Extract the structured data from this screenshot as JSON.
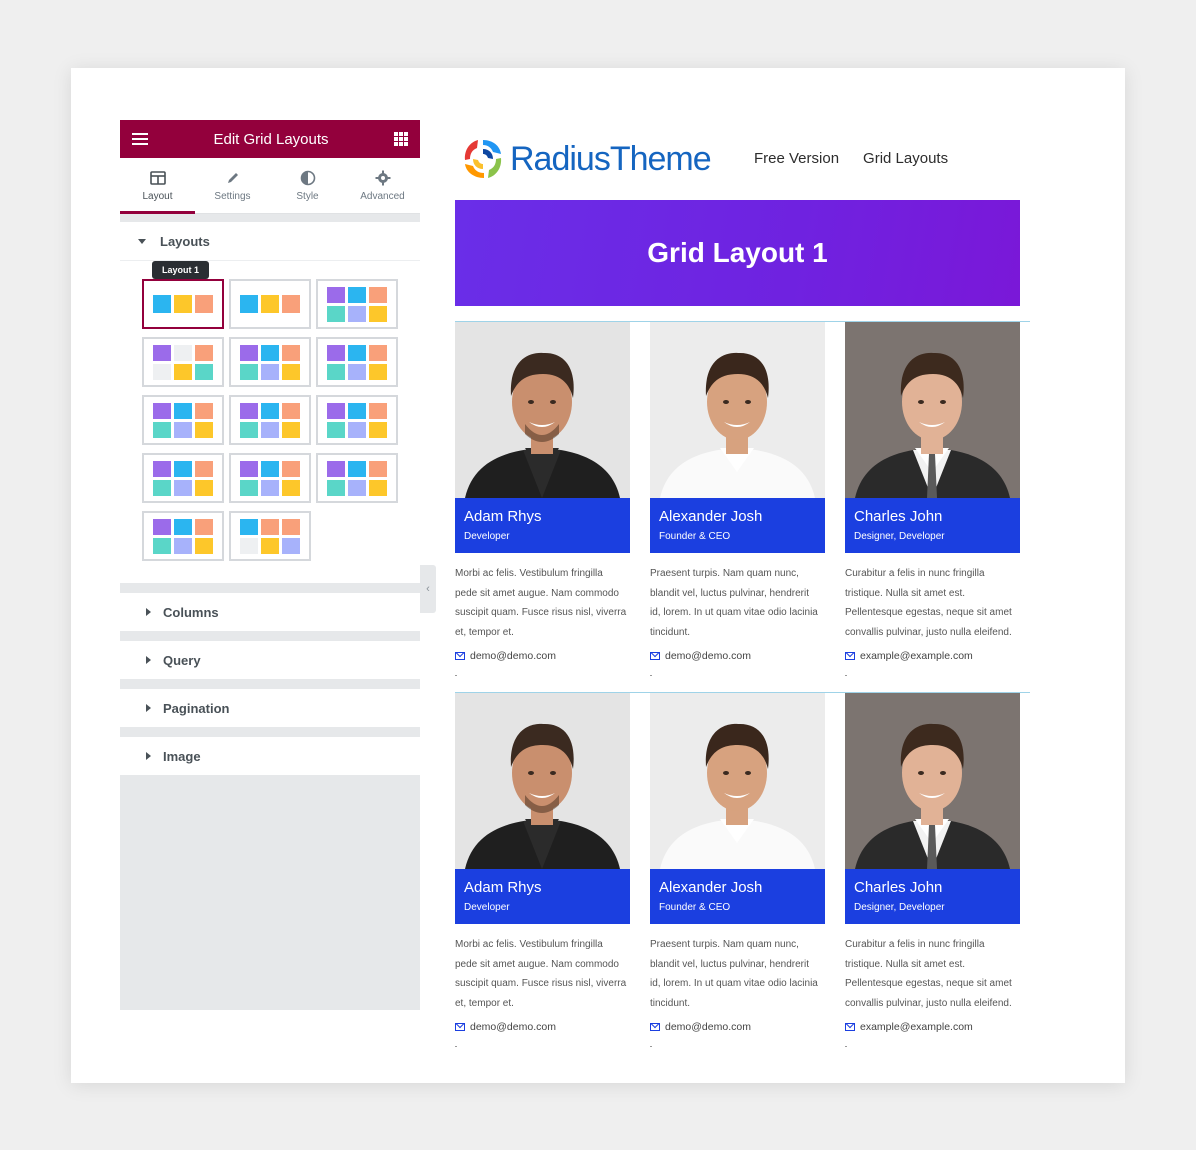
{
  "editor": {
    "title": "Edit Grid Layouts",
    "tabs": [
      {
        "label": "Layout",
        "icon": "columns-icon"
      },
      {
        "label": "Settings",
        "icon": "pencil-icon"
      },
      {
        "label": "Style",
        "icon": "contrast-icon"
      },
      {
        "label": "Advanced",
        "icon": "gear-icon"
      }
    ],
    "layouts_label": "Layouts",
    "tooltip": "Layout 1",
    "sections": [
      "Columns",
      "Query",
      "Pagination",
      "Image"
    ]
  },
  "colors": {
    "panel_accent": "#93003c",
    "banner": "#6a2ee8",
    "name_box": "#1b3fe0",
    "thumb_blue": "#2bb5f0",
    "thumb_yellow": "#fdc72a",
    "thumb_salmon": "#f9a07a",
    "thumb_purple": "#9b6bea",
    "thumb_teal": "#5ad6c8",
    "thumb_lavender": "#a7b2fb"
  },
  "site": {
    "logo_text": "RadiusTheme",
    "nav": [
      "Free Version",
      "Grid Layouts"
    ],
    "banner_title": "Grid Layout 1"
  },
  "members": [
    {
      "name": "Adam Rhys",
      "role": "Developer",
      "bio": "Morbi ac felis. Vestibulum fringilla pede sit amet augue. Nam commodo suscipit quam. Fusce risus nisl, viverra et, tempor et.",
      "email": "demo@demo.com"
    },
    {
      "name": "Alexander Josh",
      "role": "Founder & CEO",
      "bio": "Praesent turpis. Nam quam nunc, blandit vel, luctus pulvinar, hendrerit id, lorem. In ut quam vitae odio lacinia tincidunt.",
      "email": "demo@demo.com"
    },
    {
      "name": "Charles John",
      "role": "Designer, Developer",
      "bio": "Curabitur a felis in nunc fringilla tristique. Nulla sit amet est. Pellentesque egestas, neque sit amet convallis pulvinar, justo nulla eleifend.",
      "email": "example@example.com"
    },
    {
      "name": "Adam Rhys",
      "role": "Developer",
      "bio": "Morbi ac felis. Vestibulum fringilla pede sit amet augue. Nam commodo suscipit quam. Fusce risus nisl, viverra et, tempor et.",
      "email": "demo@demo.com"
    },
    {
      "name": "Alexander Josh",
      "role": "Founder & CEO",
      "bio": "Praesent turpis. Nam quam nunc, blandit vel, luctus pulvinar, hendrerit id, lorem. In ut quam vitae odio lacinia tincidunt.",
      "email": "demo@demo.com"
    },
    {
      "name": "Charles John",
      "role": "Designer, Developer",
      "bio": "Curabitur a felis in nunc fringilla tristique. Nulla sit amet est. Pellentesque egestas, neque sit amet convallis pulvinar, justo nulla eleifend.",
      "email": "example@example.com"
    }
  ]
}
